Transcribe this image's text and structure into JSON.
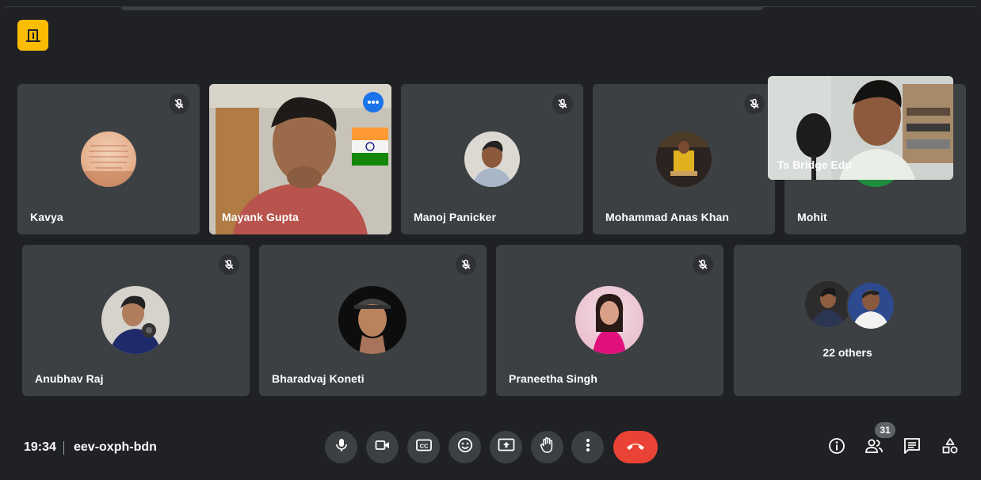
{
  "meeting": {
    "time": "19:34",
    "code": "eev-oxph-bdn"
  },
  "participants_row1": [
    {
      "name": "Kavya"
    },
    {
      "name": "Mayank Gupta"
    },
    {
      "name": "Manoj Panicker"
    },
    {
      "name": "Mohammad Anas Khan"
    },
    {
      "name": "Mohit"
    }
  ],
  "participants_row2": [
    {
      "name": "Anubhav Raj"
    },
    {
      "name": "Bharadvaj Koneti"
    },
    {
      "name": "Praneetha Singh"
    }
  ],
  "others": {
    "label": "22 others"
  },
  "self_view": {
    "name": "Ts Bridge Edu"
  },
  "people": {
    "count": "31"
  },
  "colors": {
    "active_border": "#8ab4f8",
    "end_call": "#ea4335",
    "logo": "#fbbc04",
    "tile": "#3c4043"
  },
  "icons": {
    "controls": [
      "mic-icon",
      "camera-icon",
      "captions-icon",
      "emoji-icon",
      "present-icon",
      "raise-hand-icon",
      "more-options-icon",
      "end-call-icon"
    ],
    "right": [
      "info-icon",
      "people-icon",
      "chat-icon",
      "activities-icon"
    ]
  }
}
